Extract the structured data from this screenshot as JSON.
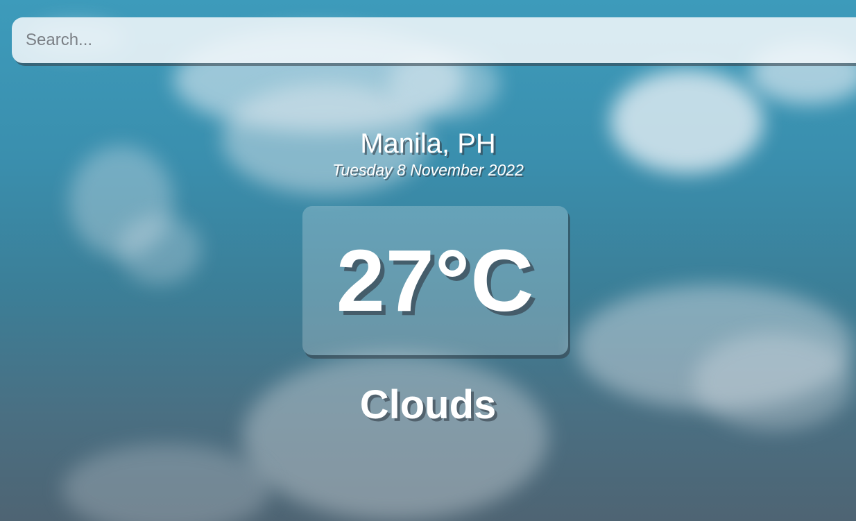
{
  "search": {
    "placeholder": "Search...",
    "value": ""
  },
  "location": {
    "city": "Manila, PH",
    "date": "Tuesday 8 November 2022"
  },
  "weather": {
    "temperature": "27°C",
    "condition": "Clouds"
  }
}
